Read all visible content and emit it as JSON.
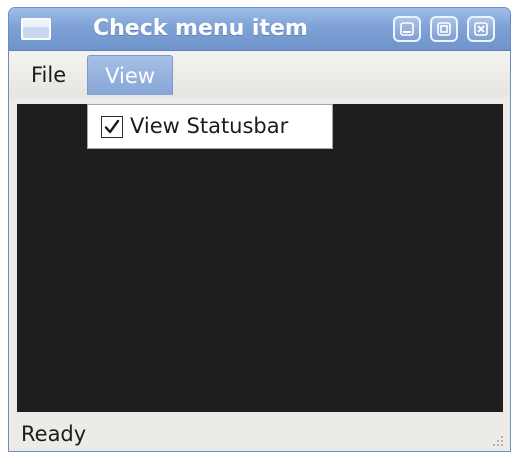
{
  "window": {
    "title": "Check menu item",
    "app_icon": "window-icon",
    "controls": [
      "minimize-icon",
      "maximize-icon",
      "close-icon"
    ]
  },
  "menubar": {
    "items": [
      {
        "label": "File",
        "active": false
      },
      {
        "label": "View",
        "active": true
      }
    ]
  },
  "dropdown": {
    "items": [
      {
        "label": "View Statusbar",
        "checked": true,
        "icon": "checkbox-checked-icon"
      }
    ]
  },
  "statusbar": {
    "text": "Ready",
    "grip_icon": "resize-grip-icon"
  },
  "colors": {
    "titlebar": "#7ea2d6",
    "menu_active": "#95b2df",
    "content_background": "#1e1e1e",
    "window_background": "#ecebe8"
  }
}
